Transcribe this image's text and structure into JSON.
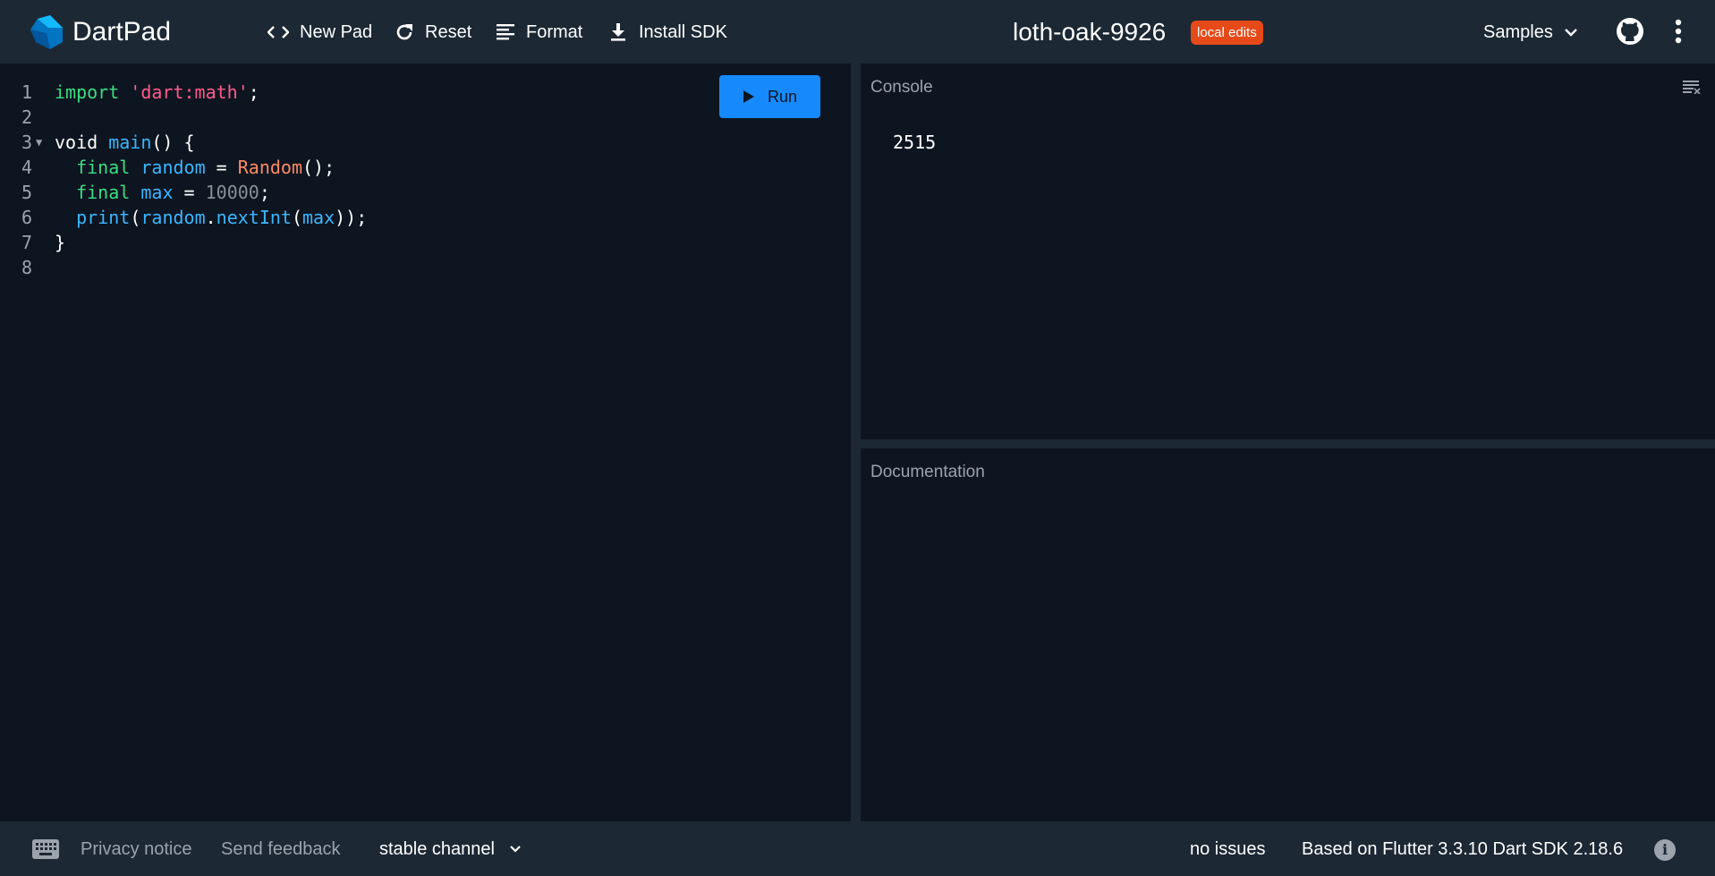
{
  "header": {
    "brand": "DartPad",
    "buttons": {
      "new_pad": "New Pad",
      "reset": "Reset",
      "format": "Format",
      "install_sdk": "Install SDK"
    },
    "pad_name": "loth-oak-9926",
    "badge": "local edits",
    "samples": "Samples"
  },
  "editor": {
    "run_label": "Run",
    "line_numbers": [
      "1",
      "2",
      "3",
      "4",
      "5",
      "6",
      "7",
      "8"
    ]
  },
  "console": {
    "title": "Console",
    "output": "2515"
  },
  "docs": {
    "title": "Documentation"
  },
  "footer": {
    "privacy": "Privacy notice",
    "feedback": "Send feedback",
    "channel": "stable channel",
    "issues": "no issues",
    "version": "Based on Flutter 3.3.10 Dart SDK 2.18.6"
  },
  "colors": {
    "accent": "#168afd",
    "badge": "#e64a19",
    "keyword": "#3ddc84",
    "string": "#ff5c8a",
    "identifier": "#3db6ff",
    "class": "#ff8a65"
  }
}
